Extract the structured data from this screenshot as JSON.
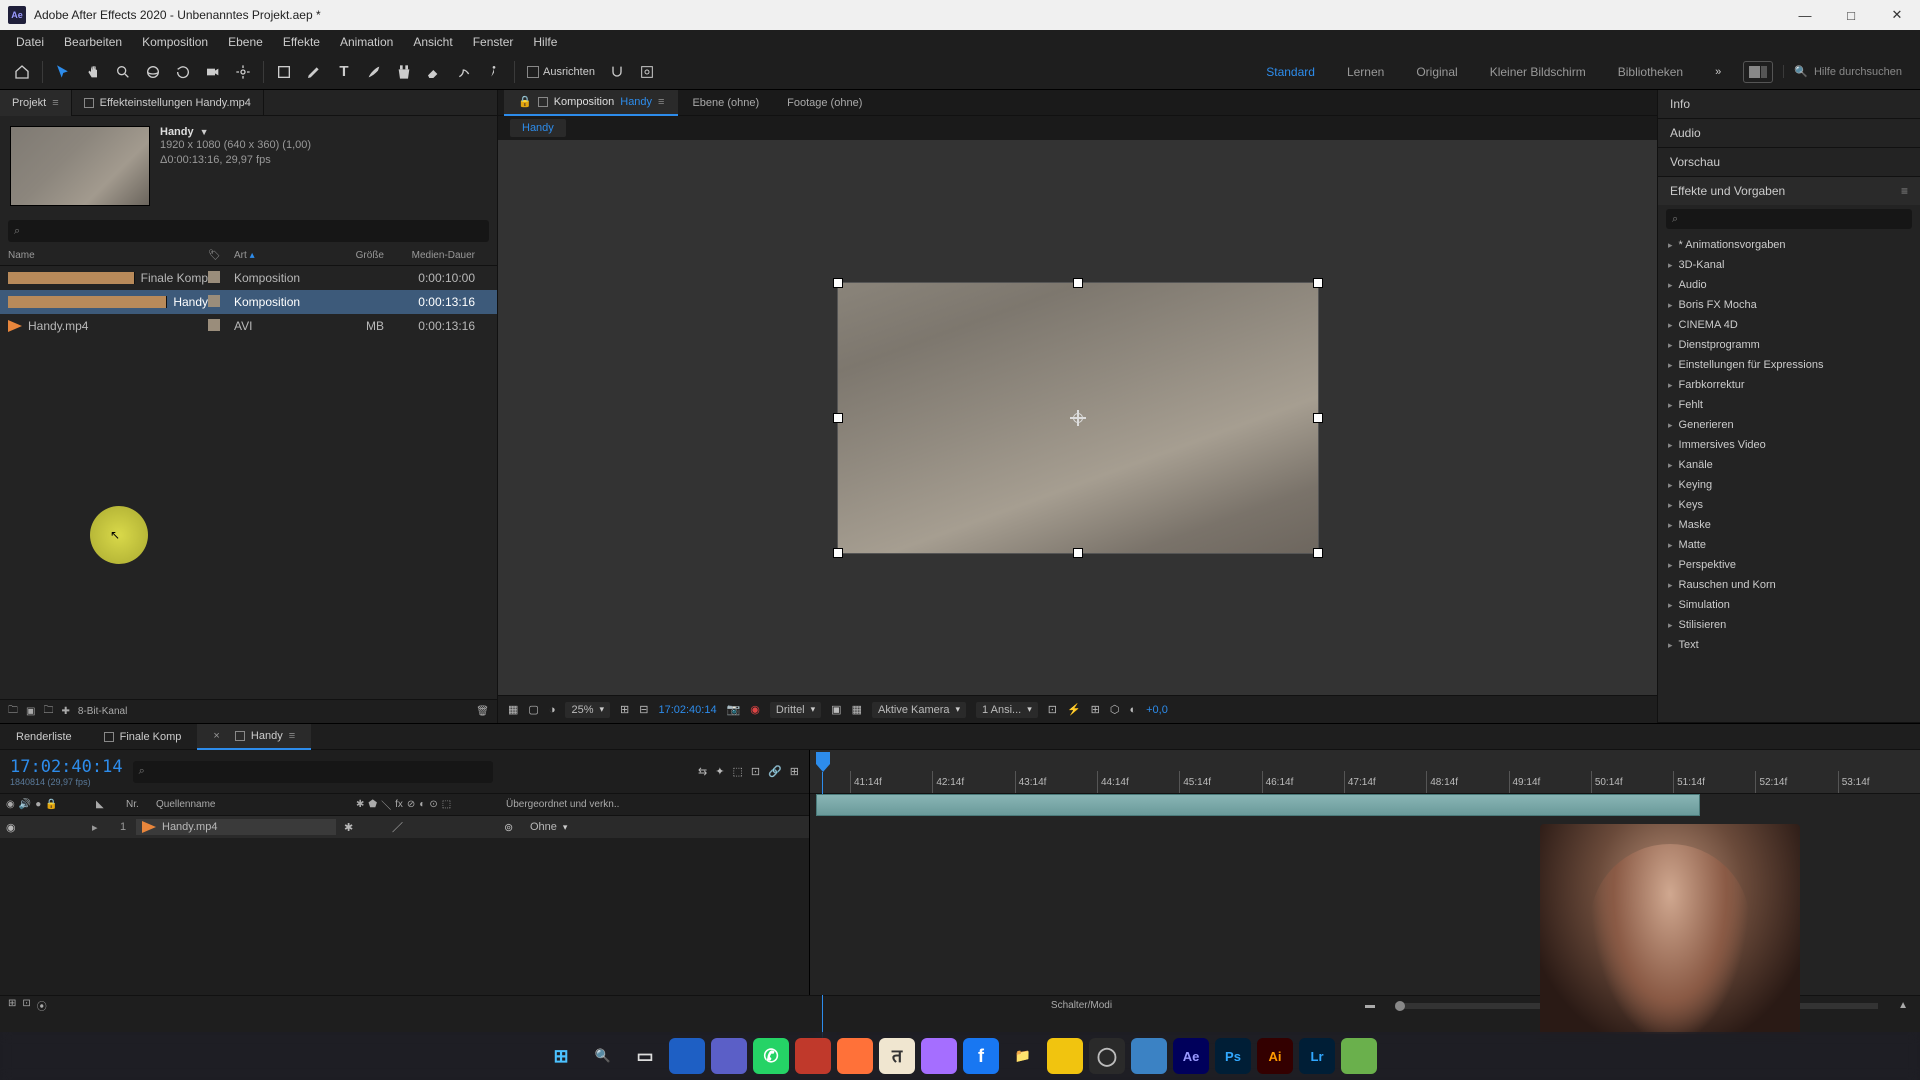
{
  "title": "Adobe After Effects 2020 - Unbenanntes Projekt.aep *",
  "menu": [
    "Datei",
    "Bearbeiten",
    "Komposition",
    "Ebene",
    "Effekte",
    "Animation",
    "Ansicht",
    "Fenster",
    "Hilfe"
  ],
  "toolbar": {
    "align_label": "Ausrichten"
  },
  "workspaces": {
    "items": [
      "Standard",
      "Lernen",
      "Original",
      "Kleiner Bildschirm",
      "Bibliotheken"
    ],
    "active": "Standard",
    "search_placeholder": "Hilfe durchsuchen"
  },
  "project_panel": {
    "tabs": {
      "project": "Projekt",
      "effect_controls": "Effekteinstellungen  Handy.mp4"
    },
    "selected": {
      "name": "Handy",
      "dims": "1920 x 1080 (640 x 360) (1,00)",
      "dur": "Δ0:00:13:16, 29,97 fps"
    },
    "columns": {
      "name": "Name",
      "tag": "",
      "type": "Art",
      "size": "Größe",
      "dur": "Medien-Dauer"
    },
    "rows": [
      {
        "icon": "comp",
        "name": "Finale Komp",
        "type": "Komposition",
        "size": "",
        "dur": "0:00:10:00",
        "sel": false
      },
      {
        "icon": "comp",
        "name": "Handy",
        "type": "Komposition",
        "size": "",
        "dur": "0:00:13:16",
        "sel": true
      },
      {
        "icon": "vid",
        "name": "Handy.mp4",
        "type": "AVI",
        "size": " MB",
        "dur": "0:00:13:16",
        "sel": false
      }
    ],
    "footer_depth": "8-Bit-Kanal"
  },
  "comp_panel": {
    "tabs": {
      "comp_prefix": "Komposition ",
      "comp_name": "Handy",
      "layer": "Ebene  (ohne)",
      "footage": "Footage  (ohne)"
    },
    "crumb": "Handy",
    "footer": {
      "zoom": "25%",
      "timecode": "17:02:40:14",
      "res": "Drittel",
      "camera": "Aktive Kamera",
      "views": "1 Ansi...",
      "exposure": "+0,0"
    }
  },
  "right_panel": {
    "groups": [
      "Info",
      "Audio",
      "Vorschau"
    ],
    "effects_title": "Effekte und Vorgaben",
    "effects": [
      "* Animationsvorgaben",
      "3D-Kanal",
      "Audio",
      "Boris FX Mocha",
      "CINEMA 4D",
      "Dienstprogramm",
      "Einstellungen für Expressions",
      "Farbkorrektur",
      "Fehlt",
      "Generieren",
      "Immersives Video",
      "Kanäle",
      "Keying",
      "Keys",
      "Maske",
      "Matte",
      "Perspektive",
      "Rauschen und Korn",
      "Simulation",
      "Stilisieren",
      "Text"
    ]
  },
  "timeline": {
    "tabs": {
      "render": "Renderliste",
      "finale": "Finale Komp",
      "handy": "Handy"
    },
    "timecode": "17:02:40:14",
    "subframe": "1840814 (29,97 fps)",
    "col_nr": "Nr.",
    "col_src": "Quellenname",
    "col_parent": "Übergeordnet und verkn..",
    "layer": {
      "nr": "1",
      "name": "Handy.mp4",
      "parent": "Ohne"
    },
    "ruler": [
      "41:14f",
      "42:14f",
      "43:14f",
      "44:14f",
      "45:14f",
      "46:14f",
      "47:14f",
      "48:14f",
      "49:14f",
      "50:14f",
      "51:14f",
      "52:14f",
      "53:14f"
    ],
    "footer_mode": "Schalter/Modi"
  },
  "taskbar": [
    {
      "name": "windows-start",
      "glyph": "⊞",
      "bg": "",
      "fg": "#4cc2ff"
    },
    {
      "name": "search",
      "glyph": "🔍",
      "bg": "",
      "fg": "#ddd"
    },
    {
      "name": "task-view",
      "glyph": "▭",
      "bg": "",
      "fg": "#ddd"
    },
    {
      "name": "app-blue",
      "glyph": "",
      "bg": "#1e5fc4",
      "fg": ""
    },
    {
      "name": "app-teams",
      "glyph": "",
      "bg": "#5b5fc7",
      "fg": ""
    },
    {
      "name": "whatsapp",
      "glyph": "✆",
      "bg": "#25d366",
      "fg": "#fff"
    },
    {
      "name": "app-red",
      "glyph": "",
      "bg": "#c0392b",
      "fg": ""
    },
    {
      "name": "firefox",
      "glyph": "",
      "bg": "#ff7139",
      "fg": ""
    },
    {
      "name": "app-figure",
      "glyph": "त",
      "bg": "#f0e6d0",
      "fg": "#333"
    },
    {
      "name": "messenger",
      "glyph": "",
      "bg": "#a56eff",
      "fg": ""
    },
    {
      "name": "facebook",
      "glyph": "f",
      "bg": "#1877f2",
      "fg": "#fff"
    },
    {
      "name": "explorer",
      "glyph": "📁",
      "bg": "",
      "fg": ""
    },
    {
      "name": "app-yellow",
      "glyph": "",
      "bg": "#f1c40f",
      "fg": ""
    },
    {
      "name": "obs",
      "glyph": "◯",
      "bg": "#2a2a2a",
      "fg": "#bbb"
    },
    {
      "name": "app-note",
      "glyph": "",
      "bg": "#3b82c4",
      "fg": ""
    },
    {
      "name": "after-effects",
      "glyph": "Ae",
      "bg": "#00005b",
      "fg": "#9a9aff"
    },
    {
      "name": "photoshop",
      "glyph": "Ps",
      "bg": "#001e36",
      "fg": "#31a8ff"
    },
    {
      "name": "illustrator",
      "glyph": "Ai",
      "bg": "#330000",
      "fg": "#ff9a00"
    },
    {
      "name": "lightroom",
      "glyph": "Lr",
      "bg": "#001e36",
      "fg": "#31a8ff"
    },
    {
      "name": "app-green",
      "glyph": "",
      "bg": "#6ab04c",
      "fg": ""
    }
  ]
}
